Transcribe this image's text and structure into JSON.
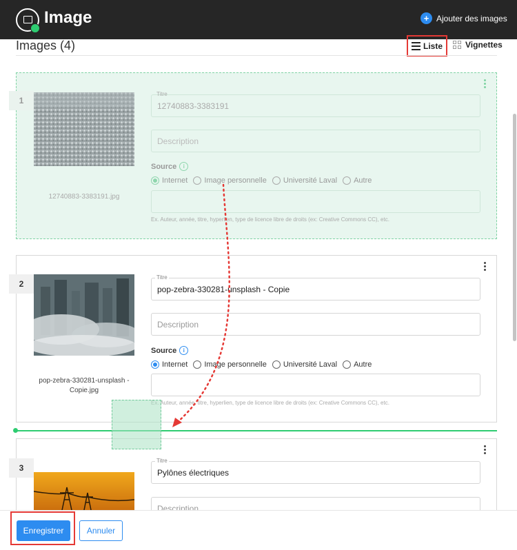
{
  "header": {
    "title": "Image",
    "add_label": "Ajouter des images",
    "icon": "image-plugin-icon"
  },
  "gallery": {
    "heading": "Images (4)",
    "view_list_label": "Liste",
    "view_grid_label": "Vignettes",
    "active_view": "Liste"
  },
  "common": {
    "title_legend": "Titre",
    "description_placeholder": "Description",
    "source_label": "Source",
    "source_options": [
      "Internet",
      "Image personnelle",
      "Université Laval",
      "Autre"
    ],
    "source_hint": "Ex. Auteur, année, titre, hyperlien, type de licence libre de droits (ex: Creative Commons CC), etc."
  },
  "cards": [
    {
      "number": "1",
      "title": "12740883-3383191",
      "filename": "12740883-3383191.jpg",
      "source": "Internet",
      "state": "dragging"
    },
    {
      "number": "2",
      "title": "pop-zebra-330281-unsplash - Copie",
      "filename": "pop-zebra-330281-unsplash - Copie.jpg",
      "source": "Internet",
      "state": "normal"
    },
    {
      "number": "3",
      "title": "Pylônes électriques",
      "filename": "",
      "source": "",
      "state": "normal"
    }
  ],
  "footer": {
    "save_label": "Enregistrer",
    "cancel_label": "Annuler"
  },
  "colors": {
    "primary": "#2d8cf0",
    "drop_indicator": "#2ecc71",
    "highlight": "#e53935",
    "topbar": "#262626"
  }
}
